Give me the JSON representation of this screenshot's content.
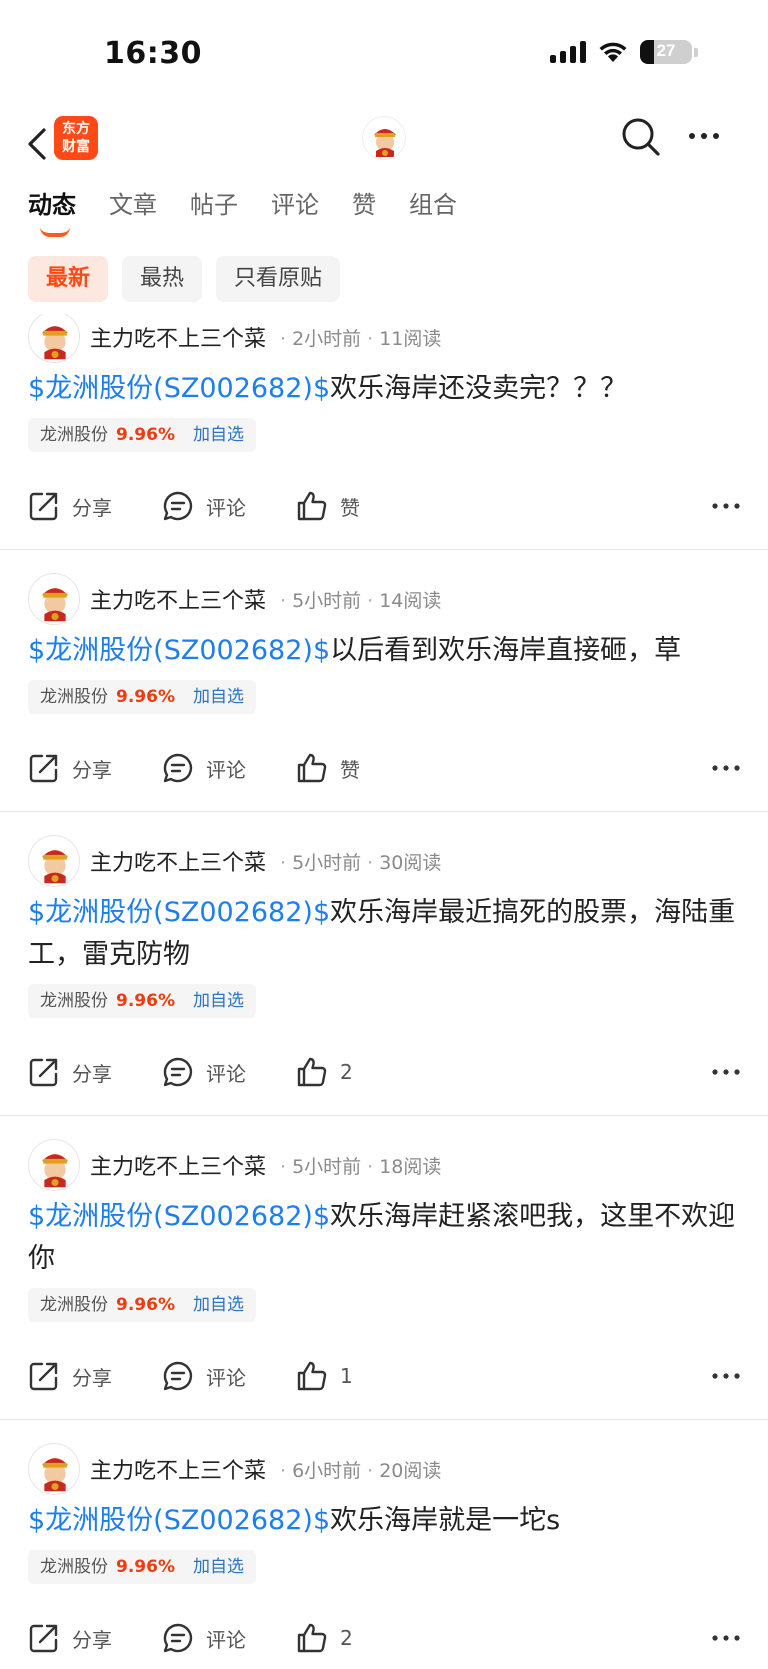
{
  "status_bar": {
    "time": "16:30",
    "battery": "27",
    "battery_level": 0.27
  },
  "nav": {
    "brand_line1": "东方",
    "brand_line2": "财富"
  },
  "tabs": [
    {
      "label": "动态",
      "active": true
    },
    {
      "label": "文章",
      "active": false
    },
    {
      "label": "帖子",
      "active": false
    },
    {
      "label": "评论",
      "active": false
    },
    {
      "label": "赞",
      "active": false
    },
    {
      "label": "组合",
      "active": false
    }
  ],
  "filters": [
    {
      "label": "最新",
      "active": true
    },
    {
      "label": "最热",
      "active": false
    },
    {
      "label": "只看原贴",
      "active": false
    }
  ],
  "colors": {
    "accent": "#ff4a17",
    "link": "#1d7ef0",
    "up": "#f03b10"
  },
  "posts": [
    {
      "author": "主力吃不上三个菜",
      "time": "2小时前",
      "reads": "11阅读",
      "stock_link": "$龙洲股份(SZ002682)$",
      "text": "欢乐海岸还没卖完？？？",
      "tag_name": "龙洲股份",
      "tag_pct": "9.96%",
      "tag_add": "加自选",
      "share": "分享",
      "comment": "评论",
      "like": "赞"
    },
    {
      "author": "主力吃不上三个菜",
      "time": "5小时前",
      "reads": "14阅读",
      "stock_link": "$龙洲股份(SZ002682)$",
      "text": "以后看到欢乐海岸直接砸，草",
      "tag_name": "龙洲股份",
      "tag_pct": "9.96%",
      "tag_add": "加自选",
      "share": "分享",
      "comment": "评论",
      "like": "赞"
    },
    {
      "author": "主力吃不上三个菜",
      "time": "5小时前",
      "reads": "30阅读",
      "stock_link": "$龙洲股份(SZ002682)$",
      "text": "欢乐海岸最近搞死的股票，海陆重工，雷克防物",
      "tag_name": "龙洲股份",
      "tag_pct": "9.96%",
      "tag_add": "加自选",
      "share": "分享",
      "comment": "评论",
      "like": "2"
    },
    {
      "author": "主力吃不上三个菜",
      "time": "5小时前",
      "reads": "18阅读",
      "stock_link": "$龙洲股份(SZ002682)$",
      "text": "欢乐海岸赶紧滚吧我，这里不欢迎你",
      "tag_name": "龙洲股份",
      "tag_pct": "9.96%",
      "tag_add": "加自选",
      "share": "分享",
      "comment": "评论",
      "like": "1"
    },
    {
      "author": "主力吃不上三个菜",
      "time": "6小时前",
      "reads": "20阅读",
      "stock_link": "$龙洲股份(SZ002682)$",
      "text": "欢乐海岸就是一坨s",
      "tag_name": "龙洲股份",
      "tag_pct": "9.96%",
      "tag_add": "加自选",
      "share": "分享",
      "comment": "评论",
      "like": "2"
    }
  ]
}
